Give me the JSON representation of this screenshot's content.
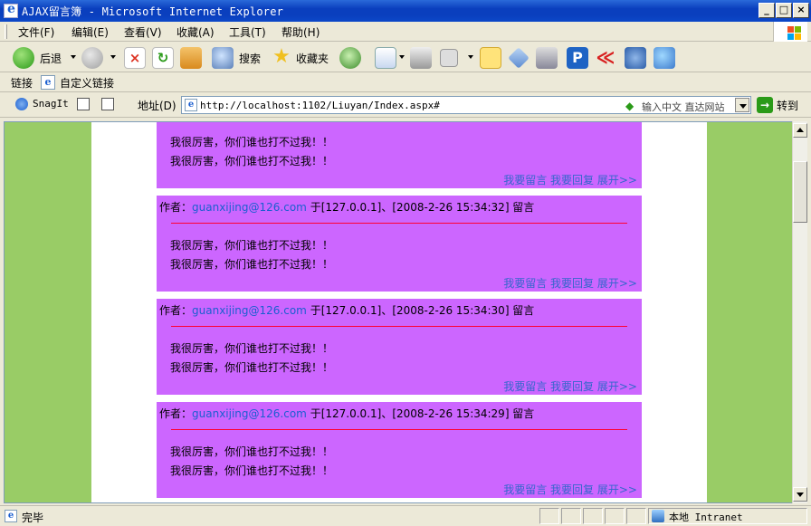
{
  "window": {
    "title": "AJAX留言簿 - Microsoft Internet Explorer"
  },
  "menu": {
    "items": [
      "文件(F)",
      "编辑(E)",
      "查看(V)",
      "收藏(A)",
      "工具(T)",
      "帮助(H)"
    ]
  },
  "toolbar": {
    "back_label": "后退",
    "search_label": "搜索",
    "favorites_label": "收藏夹"
  },
  "links": {
    "label": "链接",
    "custom_label": "自定义链接",
    "snagit_label": "SnagIt"
  },
  "address": {
    "label": "地址(D)",
    "url": "http://localhost:1102/Liuyan/Index.aspx#",
    "hint": "输入中文 直达网站",
    "go_label": "转到"
  },
  "entries": [
    {
      "author_label": "",
      "email": "",
      "meta": "",
      "lines": [
        "我很厉害，你们谁也打不过我！！",
        "我很厉害，你们谁也打不过我！！"
      ],
      "actions": [
        "我要留言",
        "我要回复",
        "展开>>"
      ]
    },
    {
      "author_label": "作者：",
      "email": "guanxijing@126.com",
      "meta": "于[127.0.0.1]、[2008-2-26 15:34:32] 留言",
      "lines": [
        "我很厉害，你们谁也打不过我！！",
        "我很厉害，你们谁也打不过我！！"
      ],
      "actions": [
        "我要留言",
        "我要回复",
        "展开>>"
      ]
    },
    {
      "author_label": "作者：",
      "email": "guanxijing@126.com",
      "meta": "于[127.0.0.1]、[2008-2-26 15:34:30] 留言",
      "lines": [
        "我很厉害，你们谁也打不过我！！",
        "我很厉害，你们谁也打不过我！！"
      ],
      "actions": [
        "我要留言",
        "我要回复",
        "展开>>"
      ]
    },
    {
      "author_label": "作者：",
      "email": "guanxijing@126.com",
      "meta": "于[127.0.0.1]、[2008-2-26 15:34:29] 留言",
      "lines": [
        "我很厉害，你们谁也打不过我！！",
        "我很厉害，你们谁也打不过我！！"
      ],
      "actions": [
        "我要留言",
        "我要回复",
        "展开>>"
      ]
    }
  ],
  "status": {
    "text": "完毕",
    "zone": "本地 Intranet"
  },
  "colors": {
    "entry_bg": "#cc66ff",
    "gutter": "#99cc66",
    "link": "#3366cc",
    "rule": "#ff0033"
  },
  "icons": [
    "back-icon",
    "forward-icon",
    "stop-icon",
    "refresh-icon",
    "home-icon",
    "search-icon",
    "favorites-icon",
    "history-icon",
    "mail-icon",
    "print-icon",
    "edit-icon",
    "folder-icon",
    "diamond-icon",
    "music-icon",
    "p-icon",
    "bird-icon",
    "windows-media-icon",
    "messenger-icon"
  ]
}
